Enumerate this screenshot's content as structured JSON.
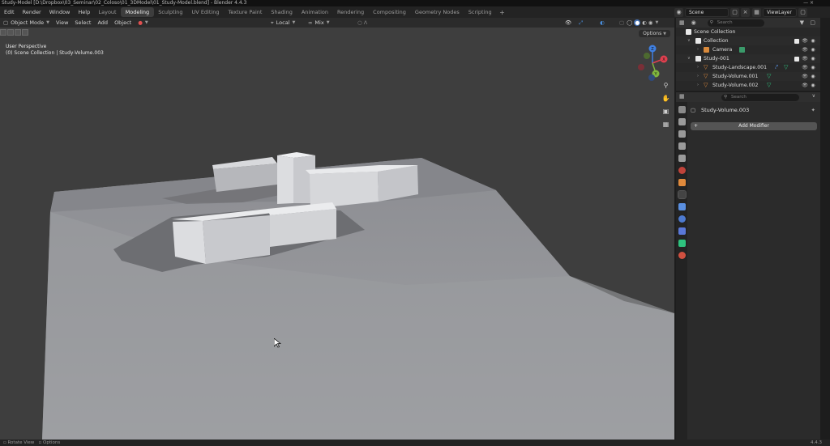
{
  "window": {
    "title": "Study-Model [D:\\Dropbox\\03_Seminar\\02_Coloso\\01_3DModel\\01_Study-Model.blend] - Blender 4.4.3",
    "controls": "—  ×"
  },
  "menu": [
    "Edit",
    "Render",
    "Window",
    "Help"
  ],
  "workspace_tabs": [
    {
      "label": "Layout",
      "active": false
    },
    {
      "label": "Modeling",
      "active": true
    },
    {
      "label": "Sculpting",
      "active": false
    },
    {
      "label": "UV Editing",
      "active": false
    },
    {
      "label": "Texture Paint",
      "active": false
    },
    {
      "label": "Shading",
      "active": false
    },
    {
      "label": "Animation",
      "active": false
    },
    {
      "label": "Rendering",
      "active": false
    },
    {
      "label": "Compositing",
      "active": false
    },
    {
      "label": "Geometry Nodes",
      "active": false
    },
    {
      "label": "Scripting",
      "active": false
    }
  ],
  "workspace_add": "+",
  "scene": {
    "name": "Scene",
    "view_layer": "ViewLayer"
  },
  "viewport": {
    "mode": "Object Mode",
    "menus": [
      "View",
      "Select",
      "Add",
      "Object"
    ],
    "transform_orientation": "Local",
    "snap_mode": "Mix",
    "options_label": "Options",
    "view_name": "User Perspective",
    "collection_info": "(0) Scene Collection | Study-Volume.003",
    "gizmo_labels": {
      "z": "Z",
      "y": "Y",
      "x": "X"
    }
  },
  "outliner": {
    "search_placeholder": "Search",
    "root": "Scene Collection",
    "rows": [
      {
        "label": "Collection",
        "type": "collection"
      },
      {
        "label": "Camera",
        "type": "camera"
      },
      {
        "label": "Study-001",
        "type": "collection"
      },
      {
        "label": "Study-Landscape.001",
        "type": "mesh"
      },
      {
        "label": "Study-Volume.001",
        "type": "mesh"
      },
      {
        "label": "Study-Volume.002",
        "type": "mesh"
      }
    ]
  },
  "properties": {
    "search_placeholder": "Search",
    "object_name": "Study-Volume.003",
    "add_modifier_label": "Add Modifier"
  },
  "statusbar": {
    "rotate_view": "Rotate View",
    "options": "Options",
    "version": "4.4.3"
  },
  "colors": {
    "accent": "#4772b3",
    "active_tab": "#3d3d3d",
    "viewport_bg": "#3e3e3e",
    "ground": "#9a9b9f",
    "x_axis": "#e0404f",
    "y_axis": "#7fb53e",
    "z_axis": "#3f7fe0"
  }
}
